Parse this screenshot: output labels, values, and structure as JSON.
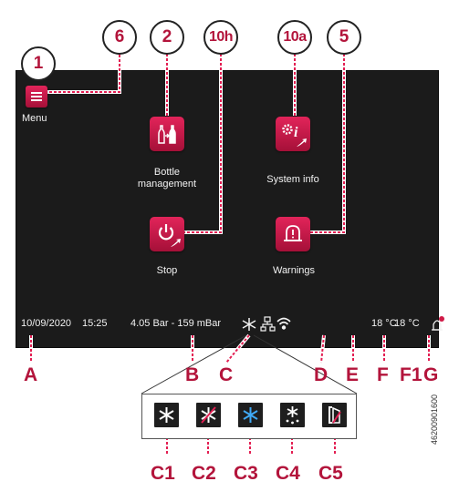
{
  "callouts": {
    "c1": "1",
    "c6": "6",
    "c2": "2",
    "c10h": "10h",
    "c10a": "10a",
    "c5": "5"
  },
  "screen": {
    "menu_label": "Menu",
    "bottle_label_line1": "Bottle",
    "bottle_label_line2": "management",
    "system_info_label": "System info",
    "stop_label": "Stop",
    "warnings_label": "Warnings"
  },
  "status_bar": {
    "date": "10/09/2020",
    "time": "15:25",
    "pressure": "4.05 Bar - 159 mBar",
    "temp_1": "18 °C",
    "temp_2": "18 °C"
  },
  "letters": {
    "a": "A",
    "b": "B",
    "c": "C",
    "d": "D",
    "e": "E",
    "f": "F",
    "f1": "F1",
    "g": "G"
  },
  "legend": {
    "c1": "C1",
    "c2": "C2",
    "c3": "C3",
    "c4": "C4",
    "c5": "C5"
  },
  "figure_id": "46200901600",
  "colors": {
    "accent": "#b3143b",
    "tile": "#cc1a4a",
    "screen": "#1b1b1b",
    "leader_dash": "#e31e52"
  },
  "icons": {
    "menu": "hamburger-icon",
    "bottle": "bottle-transfer-icon",
    "system_info": "gears-info-icon",
    "stop": "power-icon",
    "warnings": "bell-warning-icon"
  }
}
